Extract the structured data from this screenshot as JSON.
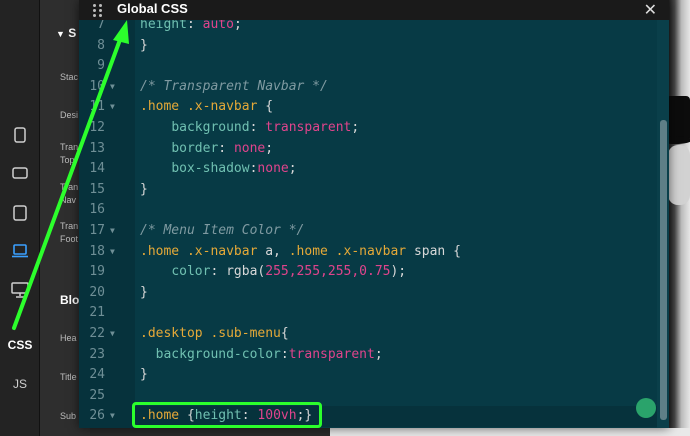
{
  "rail": {
    "css_label": "CSS",
    "js_label": "JS"
  },
  "panel": {
    "section_header": "S",
    "rows": [
      "Stac",
      "Desi",
      "Tran",
      "Top",
      "Tran",
      "Nav",
      "Tran",
      "Foot"
    ],
    "block_header": "Blo",
    "rows2": [
      "Hea",
      "Title",
      "Sub"
    ]
  },
  "window": {
    "title": "Global CSS",
    "close_glyph": "✕"
  },
  "code_lines": [
    {
      "n": "7",
      "fold": false,
      "partial": true
    },
    {
      "n": "8",
      "fold": false
    },
    {
      "n": "9",
      "fold": false
    },
    {
      "n": "10",
      "fold": true
    },
    {
      "n": "11",
      "fold": true
    },
    {
      "n": "12",
      "fold": false
    },
    {
      "n": "13",
      "fold": false
    },
    {
      "n": "14",
      "fold": false
    },
    {
      "n": "15",
      "fold": false
    },
    {
      "n": "16",
      "fold": false
    },
    {
      "n": "17",
      "fold": true
    },
    {
      "n": "18",
      "fold": true
    },
    {
      "n": "19",
      "fold": false
    },
    {
      "n": "20",
      "fold": false
    },
    {
      "n": "21",
      "fold": false
    },
    {
      "n": "22",
      "fold": true
    },
    {
      "n": "23",
      "fold": false
    },
    {
      "n": "24",
      "fold": false
    },
    {
      "n": "25",
      "fold": false
    },
    {
      "n": "26",
      "fold": true
    }
  ],
  "code": {
    "l7_prop": "height",
    "l7_val": "auto",
    "l8": "}",
    "l10_comment": "/* Transparent Navbar */",
    "l11_sel": ".home .x-navbar",
    "l11_brace": " {",
    "l12_prop": "background",
    "l12_val": "transparent",
    "l13_prop": "border",
    "l13_val": "none",
    "l14_prop": "box-shadow",
    "l14_val": "none",
    "l15": "}",
    "l17_comment": "/* Menu Item Color */",
    "l18_sel1": ".home .x-navbar",
    "l18_a": " a, ",
    "l18_sel2": ".home .x-navbar",
    "l18_span": " span {",
    "l19_prop": "color",
    "l19_fn": "rgba(",
    "l19_args": "255,255,255,0.75",
    "l19_end": ");",
    "l20": "}",
    "l22_sel": ".desktop .sub-menu",
    "l22_brace": "{",
    "l23_prop": "background-color",
    "l23_val": "transparent",
    "l24": "}",
    "l26_sel": ".home",
    "l26_open": " {",
    "l26_prop": "height",
    "l26_val": "100vh",
    "l26_close": ";}"
  },
  "colors": {
    "editor_bg": "#073a45",
    "selector": "#e5a938",
    "property": "#70c0b1",
    "value": "#e0448c",
    "annotation": "#2cff2c"
  }
}
